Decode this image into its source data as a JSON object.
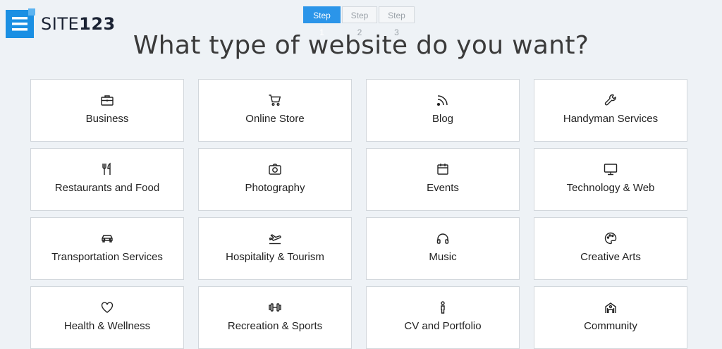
{
  "brand": {
    "name_prefix": "SITE",
    "name_suffix": "123",
    "accent": "#1a8fe3"
  },
  "steps": [
    "Step 1",
    "Step 2",
    "Step 3"
  ],
  "active_step": 1,
  "title": "What type of website do you want?",
  "categories": [
    {
      "label": "Business",
      "icon": "briefcase-icon"
    },
    {
      "label": "Online Store",
      "icon": "cart-icon"
    },
    {
      "label": "Blog",
      "icon": "rss-icon"
    },
    {
      "label": "Handyman Services",
      "icon": "wrench-icon"
    },
    {
      "label": "Restaurants and Food",
      "icon": "utensils-icon"
    },
    {
      "label": "Photography",
      "icon": "camera-icon"
    },
    {
      "label": "Events",
      "icon": "calendar-icon"
    },
    {
      "label": "Technology & Web",
      "icon": "monitor-icon"
    },
    {
      "label": "Transportation Services",
      "icon": "car-icon"
    },
    {
      "label": "Hospitality & Tourism",
      "icon": "plane-icon"
    },
    {
      "label": "Music",
      "icon": "headphones-icon"
    },
    {
      "label": "Creative Arts",
      "icon": "palette-icon"
    },
    {
      "label": "Health & Wellness",
      "icon": "heart-icon"
    },
    {
      "label": "Recreation & Sports",
      "icon": "dumbbell-icon"
    },
    {
      "label": "CV and Portfolio",
      "icon": "person-icon"
    },
    {
      "label": "Community",
      "icon": "building-icon"
    }
  ]
}
